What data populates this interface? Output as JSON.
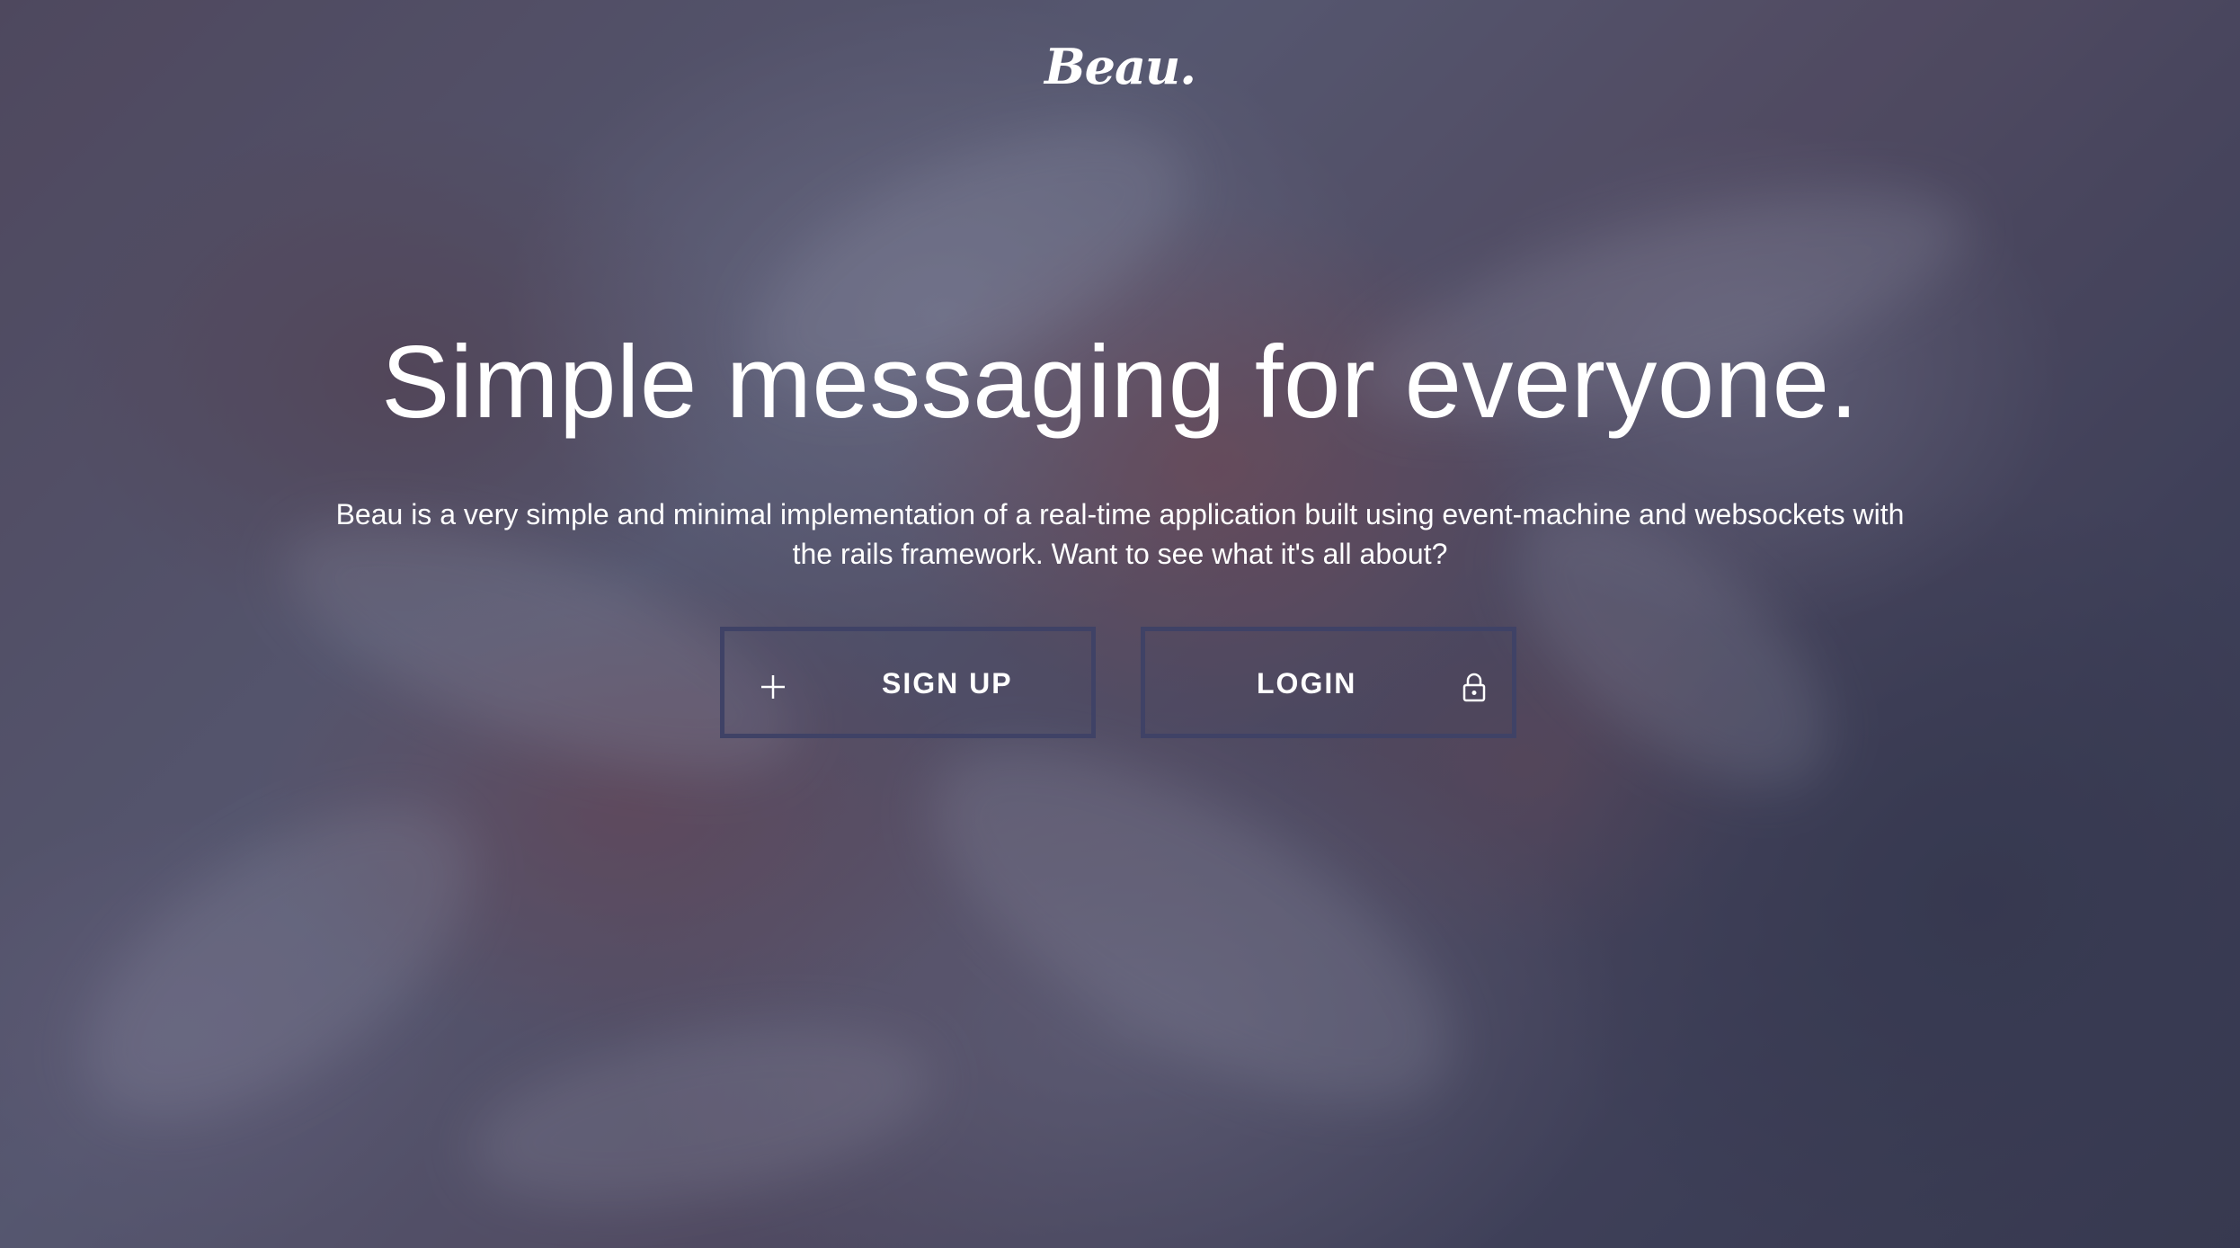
{
  "brand": {
    "logo_text": "Beau."
  },
  "hero": {
    "headline": "Simple messaging for everyone.",
    "description": "Beau is a very simple and minimal implementation of a real-time application built using event-machine and websockets with the rails framework. Want to see what it's all about?"
  },
  "actions": {
    "signup_label": "SIGN UP",
    "signup_icon": "plus-icon",
    "login_label": "LOGIN",
    "login_icon": "lock-icon"
  },
  "colors": {
    "overlay": "#3b3c52",
    "button_border": "#3f4266",
    "text": "#ffffff"
  }
}
